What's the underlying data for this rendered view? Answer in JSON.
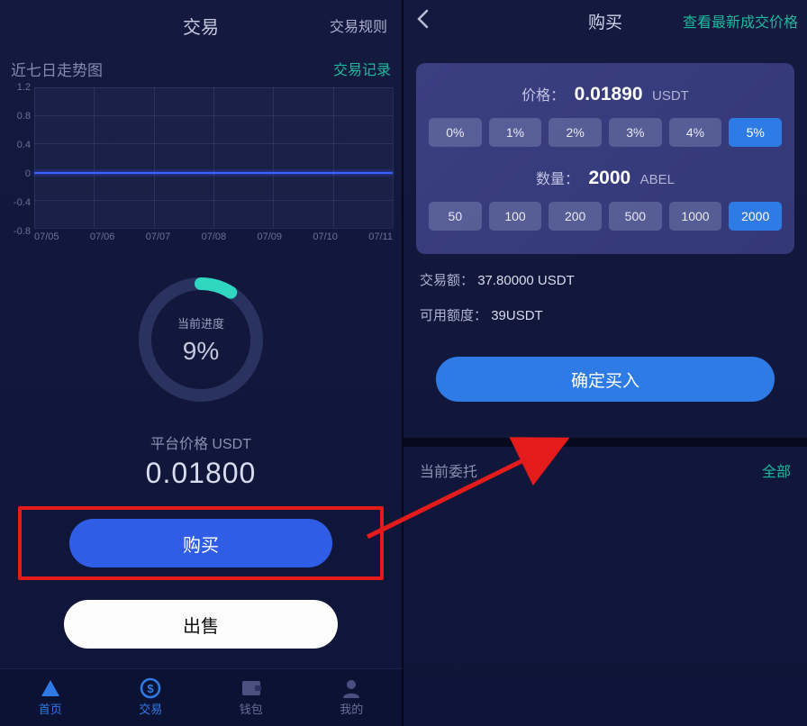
{
  "left": {
    "header": {
      "title": "交易",
      "rules": "交易规则"
    },
    "sub": {
      "left": "近七日走势图",
      "right": "交易记录"
    },
    "chart_data": {
      "type": "line",
      "title": "近七日走势图",
      "x": [
        "07/05",
        "07/06",
        "07/07",
        "07/08",
        "07/09",
        "07/10",
        "07/11"
      ],
      "values": [
        0.0,
        0.0,
        0.0,
        0.0,
        0.0,
        0.0,
        0.0
      ],
      "ylim": [
        -0.8,
        1.2
      ],
      "yticks": [
        1.2,
        0.8,
        0.4,
        0.0,
        -0.4,
        -0.8
      ],
      "xlabel": "",
      "ylabel": ""
    },
    "progress": {
      "label": "当前进度",
      "value": "9%",
      "percent": 9
    },
    "price": {
      "label": "平台价格 USDT",
      "value": "0.01800"
    },
    "buttons": {
      "buy": "购买",
      "sell": "出售"
    },
    "tabs": [
      {
        "label": "首页",
        "icon": "home"
      },
      {
        "label": "交易",
        "icon": "trade"
      },
      {
        "label": "钱包",
        "icon": "wallet"
      },
      {
        "label": "我的",
        "icon": "profile"
      }
    ]
  },
  "right": {
    "header": {
      "title": "购买",
      "link": "查看最新成交价格"
    },
    "card": {
      "price_label": "价格：",
      "price_value": "0.01890",
      "price_unit": "USDT",
      "percent_options": [
        "0%",
        "1%",
        "2%",
        "3%",
        "4%",
        "5%"
      ],
      "percent_active_index": 5,
      "qty_label": "数量：",
      "qty_value": "2000",
      "qty_unit": "ABEL",
      "qty_options": [
        "50",
        "100",
        "200",
        "500",
        "1000",
        "2000"
      ],
      "qty_active_index": 5
    },
    "info": {
      "amount_label": "交易额：",
      "amount_value": "37.80000 USDT",
      "avail_label": "可用额度：",
      "avail_value": "39USDT"
    },
    "confirm": "确定买入",
    "orders": {
      "label": "当前委托",
      "all": "全部"
    }
  }
}
